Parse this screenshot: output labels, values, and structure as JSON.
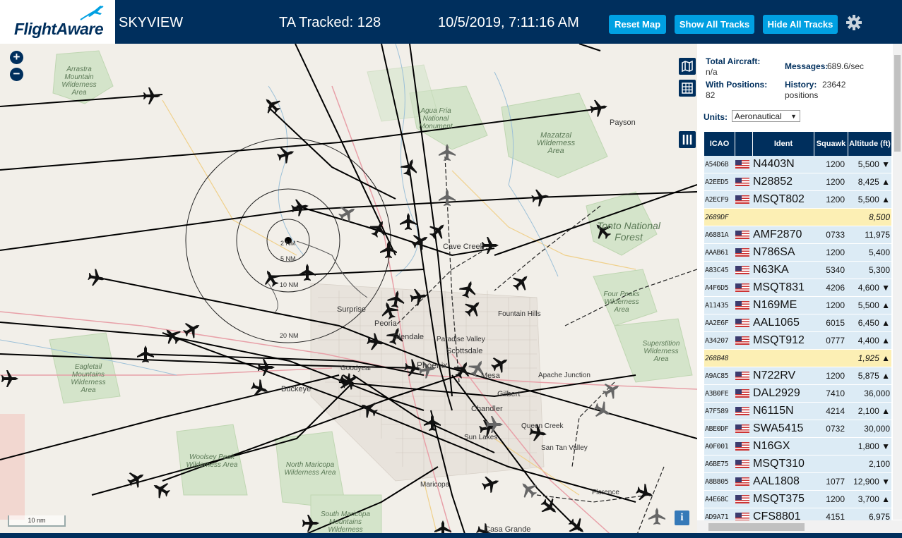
{
  "header": {
    "logo_text": "FlightAware",
    "app_title": "SKYVIEW",
    "tracked": "TA Tracked: 128",
    "datetime": "10/5/2019, 7:11:16 AM",
    "reset_label": "Reset Map",
    "show_label": "Show All Tracks",
    "hide_label": "Hide All Tracks"
  },
  "map": {
    "zoom_in": "+",
    "zoom_out": "−",
    "scale": "10 nm",
    "info": "i",
    "ranges": [
      "2 NM",
      "5 NM",
      "10 NM",
      "20 NM"
    ],
    "areas": [
      "Arrastra Mountain Wilderness Area",
      "Agua Fria National Monument",
      "Mazatzal Wilderness Area",
      "Tonto National Forest",
      "Four Peaks Wilderness Area",
      "Superstition Wilderness Area",
      "Eagletail Mountains Wilderness Area",
      "Woolsey Peak Wilderness Area",
      "North Maricopa Wilderness Area",
      "South Maricopa Mountains Wilderness"
    ],
    "cities": [
      "Payson",
      "Cave Creek",
      "Surprise",
      "Peoria",
      "Glendale",
      "Paradise Valley",
      "Scottsdale",
      "Fountain Hills",
      "Phoenix",
      "Goodyear",
      "Buckeye",
      "Mesa",
      "Apache Junction",
      "Gilbert",
      "Chandler",
      "Queen Creek",
      "San Tan Valley",
      "Sun Lakes",
      "Maricopa",
      "Florence",
      "Casa Grande"
    ]
  },
  "sidebar": {
    "total_label": "Total Aircraft:",
    "total_value": "n/a",
    "positions_label": "With Positions:",
    "positions_value": "82",
    "messages_label": "Messages:",
    "messages_value": "689.6/sec",
    "history_label": "History:",
    "history_value": "23642 positions",
    "units_label": "Units:",
    "units_value": "Aeronautical"
  },
  "table": {
    "headers": {
      "icao": "ICAO",
      "ident": "Ident",
      "squawk": "Squawk",
      "altitude": "Altitude (ft)"
    },
    "rows": [
      {
        "icao": "A54D6B",
        "ident": "N4403N",
        "squawk": "1200",
        "alt": "5,500 ▼",
        "flag": true,
        "hl": false
      },
      {
        "icao": "A2EED5",
        "ident": "N28852",
        "squawk": "1200",
        "alt": "8,425 ▲",
        "flag": true,
        "hl": false
      },
      {
        "icao": "A2ECF9",
        "ident": "MSQT802",
        "squawk": "1200",
        "alt": "5,500 ▲",
        "flag": true,
        "hl": false
      },
      {
        "icao": "2689DF",
        "ident": "",
        "squawk": "",
        "alt": "8,500",
        "flag": false,
        "hl": true
      },
      {
        "icao": "A6881A",
        "ident": "AMF2870",
        "squawk": "0733",
        "alt": "11,975",
        "flag": true,
        "hl": false
      },
      {
        "icao": "AAAB61",
        "ident": "N786SA",
        "squawk": "1200",
        "alt": "5,400",
        "flag": true,
        "hl": false
      },
      {
        "icao": "A83C45",
        "ident": "N63KA",
        "squawk": "5340",
        "alt": "5,300",
        "flag": true,
        "hl": false
      },
      {
        "icao": "A4F6D5",
        "ident": "MSQT831",
        "squawk": "4206",
        "alt": "4,600 ▼",
        "flag": true,
        "hl": false
      },
      {
        "icao": "A11435",
        "ident": "N169ME",
        "squawk": "1200",
        "alt": "5,500 ▲",
        "flag": true,
        "hl": false
      },
      {
        "icao": "AA2E6F",
        "ident": "AAL1065",
        "squawk": "6015",
        "alt": "6,450 ▲",
        "flag": true,
        "hl": false
      },
      {
        "icao": "A34207",
        "ident": "MSQT912",
        "squawk": "0777",
        "alt": "4,400 ▲",
        "flag": true,
        "hl": false
      },
      {
        "icao": "268B48",
        "ident": "",
        "squawk": "",
        "alt": "1,925 ▲",
        "flag": false,
        "hl": true
      },
      {
        "icao": "A9AC85",
        "ident": "N722RV",
        "squawk": "1200",
        "alt": "5,875 ▲",
        "flag": true,
        "hl": false
      },
      {
        "icao": "A3B0FE",
        "ident": "DAL2929",
        "squawk": "7410",
        "alt": "36,000",
        "flag": true,
        "hl": false
      },
      {
        "icao": "A7F589",
        "ident": "N6115N",
        "squawk": "4214",
        "alt": "2,100 ▲",
        "flag": true,
        "hl": false
      },
      {
        "icao": "ABE0DF",
        "ident": "SWA5415",
        "squawk": "0732",
        "alt": "30,000",
        "flag": true,
        "hl": false
      },
      {
        "icao": "A0F001",
        "ident": "N16GX",
        "squawk": "",
        "alt": "1,800 ▼",
        "flag": true,
        "hl": false
      },
      {
        "icao": "A6BE75",
        "ident": "MSQT310",
        "squawk": "",
        "alt": "2,100",
        "flag": true,
        "hl": false
      },
      {
        "icao": "A8B805",
        "ident": "AAL1808",
        "squawk": "1077",
        "alt": "12,900 ▼",
        "flag": true,
        "hl": false
      },
      {
        "icao": "A4E68C",
        "ident": "MSQT375",
        "squawk": "1200",
        "alt": "3,700 ▲",
        "flag": true,
        "hl": false
      },
      {
        "icao": "AD9A71",
        "ident": "CFS8801",
        "squawk": "4151",
        "alt": "6,975",
        "flag": true,
        "hl": false
      }
    ]
  },
  "colors": {
    "header": "#002f5d",
    "button": "#00a0e2",
    "row": "#dcebf5",
    "highlight": "#fcefb4"
  }
}
